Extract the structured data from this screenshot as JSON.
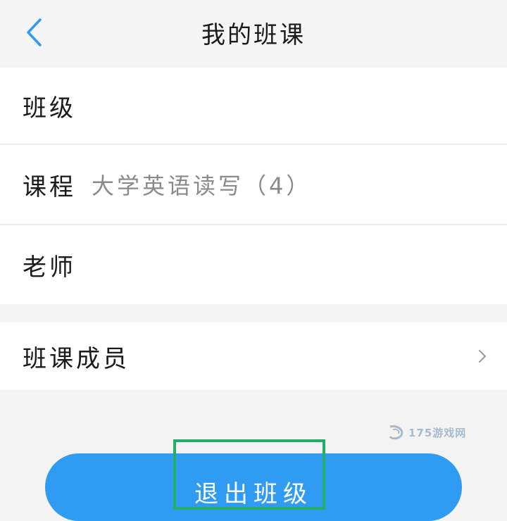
{
  "header": {
    "title": "我的班课",
    "back_icon": "chevron-left-icon"
  },
  "rows": {
    "class_label": "班级",
    "course_label": "课程",
    "course_value": "大学英语读写（4）",
    "teacher_label": "老师",
    "members_label": "班课成员",
    "members_chevron": "chevron-right-icon"
  },
  "watermark": {
    "text": "175游戏网"
  },
  "actions": {
    "exit_label": "退出班级"
  },
  "colors": {
    "accent": "#2f9bf2",
    "highlight": "#20b069",
    "background": "#f3f3f3"
  }
}
